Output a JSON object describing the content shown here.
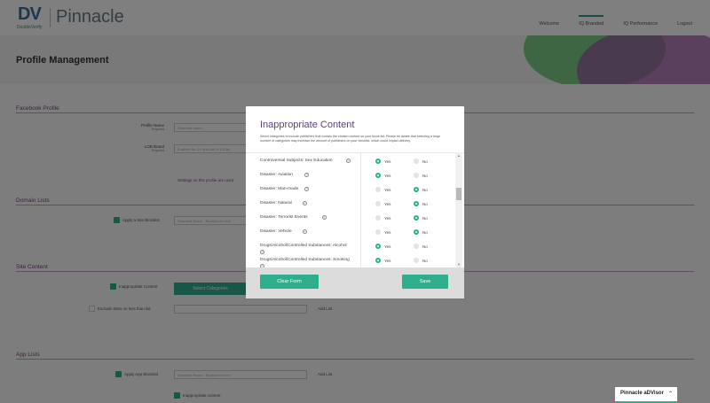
{
  "header": {
    "logo_text": "DV",
    "logo_sub": "DoubleVerify",
    "brand": "Pinnacle",
    "nav": [
      "Welcome",
      "IQ Branded",
      "IQ Performance",
      "Logout"
    ]
  },
  "hero": {
    "title": "Profile Management"
  },
  "background": {
    "sections": [
      "Facebook Profile",
      "Domain Lists",
      "Site Content",
      "App Lists"
    ],
    "profile_name_label": "Profile Name",
    "profile_name_sub": "Required",
    "profile_name_placeholder": "Standard brand",
    "lob_label": "LOB Brand",
    "lob_sub": "Required",
    "lob_placeholder": "Enabled for DV and Not in DV list",
    "settings_note": "Settings on this profile are used",
    "apply_blocklist": "Apply a Site Blocklist",
    "blocklist_placeholder": "Standard Brand - Blocklist for test",
    "inappropriate_content": "Inappropriate Content",
    "select_categories": "Select Categories",
    "exclude_sites": "Exclude Sites on less than list",
    "apply_app_blocklist": "Apply App Blocklist",
    "app_blocklist_placeholder": "Standard Brand - Blocklist for test",
    "add_list": "Add List",
    "inapp_content": "Inappropriate content"
  },
  "advisor": {
    "label": "Pinnacle aDVisor"
  },
  "modal": {
    "title": "Inappropriate Content",
    "description": "Select categories to include publishers that contain the chosen content on your block list. Please be aware that selecting a large number of categories may increase the amount of publishers on your blocklist, which could impact delivery.",
    "yes_label": "Yes",
    "no_label": "No",
    "rows": [
      {
        "label": "Controversial Subjects: Sex Education",
        "selected": "yes"
      },
      {
        "label": "Disaster: Aviation",
        "selected": "yes"
      },
      {
        "label": "Disaster: Man-made",
        "selected": "no"
      },
      {
        "label": "Disaster: Natural",
        "selected": "no"
      },
      {
        "label": "Disaster: Terrorist Events",
        "selected": "no"
      },
      {
        "label": "Disaster: Vehicle",
        "selected": "no"
      },
      {
        "label": "Drugs/Alcohol/Controlled Substances: Alcohol",
        "selected": "yes"
      },
      {
        "label": "Drugs/Alcohol/Controlled Substances: Smoking",
        "selected": "yes"
      }
    ],
    "clear_label": "Clear Form",
    "save_label": "Save"
  },
  "colors": {
    "accent": "#2fae8e",
    "title": "#5a3f8a",
    "section": "#7a3f7f"
  }
}
